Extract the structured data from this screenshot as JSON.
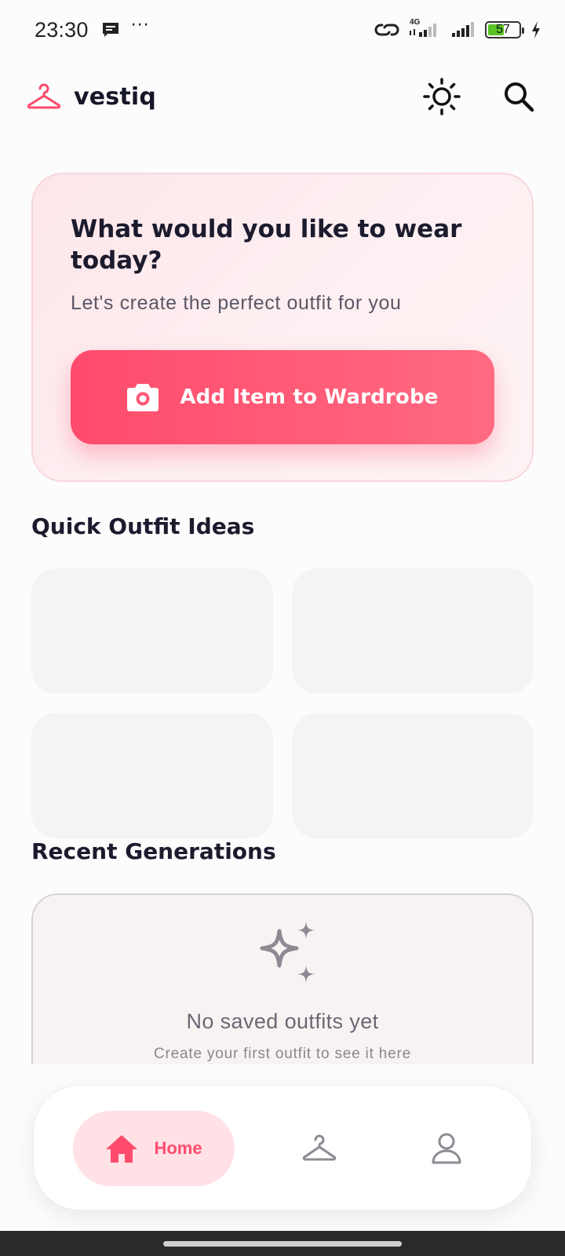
{
  "status_bar": {
    "time": "23:30",
    "more": "···",
    "network": "4G",
    "battery_text": "57",
    "battery_level": 0.57,
    "icons": [
      "message-icon",
      "link-icon",
      "signal-4g-icon",
      "signal-icon",
      "battery-icon",
      "charging-icon"
    ]
  },
  "header": {
    "app_name": "vestiq",
    "icons": [
      "hanger-logo-icon",
      "sun-icon",
      "search-icon"
    ]
  },
  "hero": {
    "title": "What would you like to wear today?",
    "subtitle": "Let's create the perfect outfit for you",
    "button_label": "Add Item to Wardrobe",
    "button_icon": "camera-icon"
  },
  "quick_ideas": {
    "title": "Quick Outfit Ideas",
    "cards_count": 4
  },
  "recent": {
    "title": "Recent Generations",
    "empty_icon": "sparkles-icon",
    "empty_title": "No saved outfits yet",
    "empty_subtitle": "Create your first outfit to see it here"
  },
  "bottom_nav": {
    "items": [
      {
        "label": "Home",
        "icon": "home-icon",
        "active": true
      },
      {
        "label": "",
        "icon": "hanger-icon",
        "active": false
      },
      {
        "label": "",
        "icon": "profile-icon",
        "active": false
      }
    ]
  },
  "colors": {
    "accent": "#ff4b6c",
    "accent_light": "#ffe1e6",
    "hero_bg": "#fde9ed",
    "text_dark": "#1c1b2e",
    "text_muted": "#6b6774",
    "card_placeholder": "#f4f4f4",
    "icon_gray": "#8e8a93"
  }
}
